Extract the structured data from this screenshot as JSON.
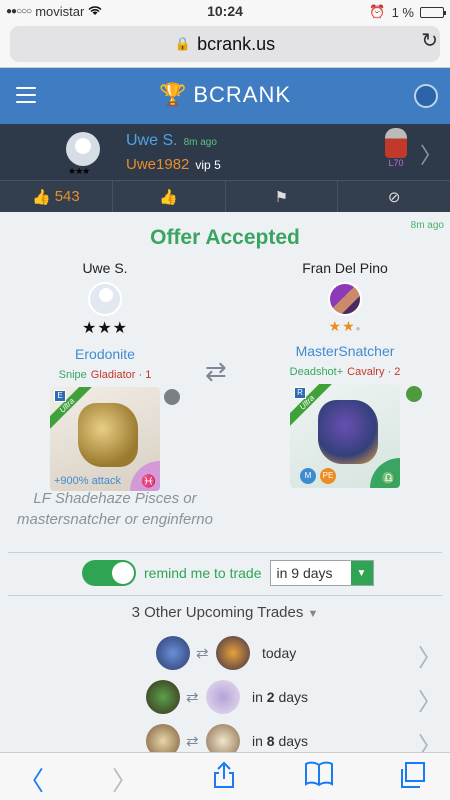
{
  "status_bar": {
    "carrier": "movistar",
    "time": "10:24",
    "battery": "1 %"
  },
  "browser": {
    "url": "bcrank.us"
  },
  "app": {
    "brand": "BCRANK"
  },
  "profile": {
    "name": "Uwe S.",
    "time_ago": "8m ago",
    "username": "Uwe1982",
    "vip": "vip 5",
    "stars": "★★★",
    "level": "L70",
    "like_count": "543"
  },
  "offer": {
    "time_ago": "8m ago",
    "status": "Offer Accepted",
    "left": {
      "trader": "Uwe S.",
      "stars": "★★★",
      "monster": "Erodonite",
      "tag1": "Snipe",
      "tag2": "Gladiator · 1",
      "tier": "E",
      "ribbon": "Ultra",
      "boost": "+900% attack",
      "sign": "♓"
    },
    "right": {
      "trader": "Fran Del Pino",
      "stars": "★★",
      "monster": "MasterSnatcher",
      "tag1": "Deadshot+",
      "tag2": "Cavalry · 2",
      "tier": "R",
      "ribbon": "Ultra",
      "sign": "♎",
      "badges": [
        "M",
        "PE"
      ]
    },
    "note": "LF Shadehaze Pisces or mastersnatcher or enginferno"
  },
  "reminder": {
    "label": "remind me to trade",
    "selected": "in 9 days",
    "enabled": true
  },
  "upcoming": {
    "title": "3 Other Upcoming Trades",
    "trades": [
      {
        "when": "today",
        "when_pre": "",
        "when_bold": ""
      },
      {
        "when": "",
        "when_pre": "in ",
        "when_bold": "2",
        "when_post": " days"
      },
      {
        "when": "",
        "when_pre": "in ",
        "when_bold": "8",
        "when_post": " days"
      }
    ]
  },
  "colors": {
    "accent": "#3f7cc1",
    "success": "#3aa562",
    "orange": "#ec8c23"
  }
}
